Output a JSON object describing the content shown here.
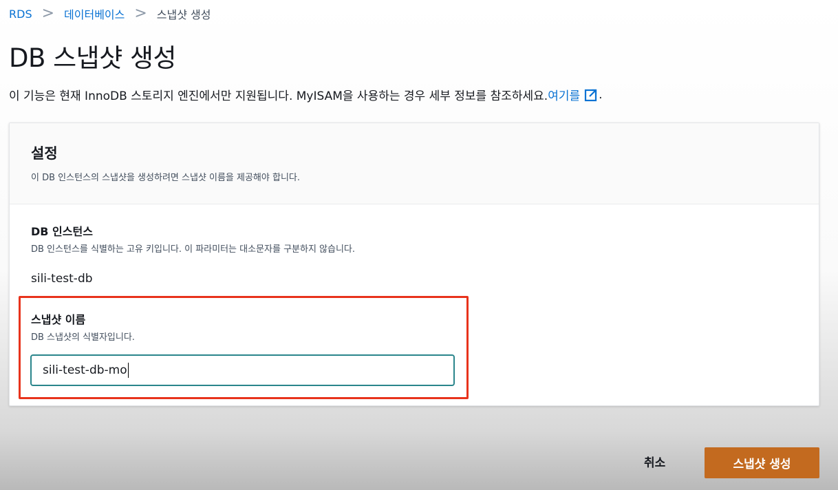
{
  "breadcrumb": {
    "items": [
      "RDS",
      "데이터베이스",
      "스냅샷 생성"
    ],
    "separator": ">"
  },
  "page": {
    "title": "DB 스냅샷 생성",
    "description": "이 기능은 현재 InnoDB 스토리지 엔진에서만 지원됩니다. MyISAM을 사용하는 경우 세부 정보를 참조하세요.",
    "link_text": "여기를",
    "link_suffix": ".",
    "link_icon": "external-link-icon"
  },
  "settings": {
    "title": "설정",
    "subtitle": "이 DB 인스턴스의 스냅샷을 생성하려면 스냅샷 이름을 제공해야 합니다.",
    "instance": {
      "label": "DB 인스턴스",
      "description": "DB 인스턴스를 식별하는 고유 키입니다. 이 파라미터는 대소문자를 구분하지 않습니다.",
      "value": "sili-test-db"
    },
    "snapshot_name": {
      "label": "스냅샷 이름",
      "description": "DB 스냅샷의 식별자입니다.",
      "value": "sili-test-db-mo"
    }
  },
  "actions": {
    "cancel_label": "취소",
    "submit_label": "스냅샷 생성"
  },
  "colors": {
    "link": "#0972d3",
    "primary_button": "#c36a1f",
    "highlight_border": "#e8331c",
    "input_focus_border": "#29858b"
  }
}
